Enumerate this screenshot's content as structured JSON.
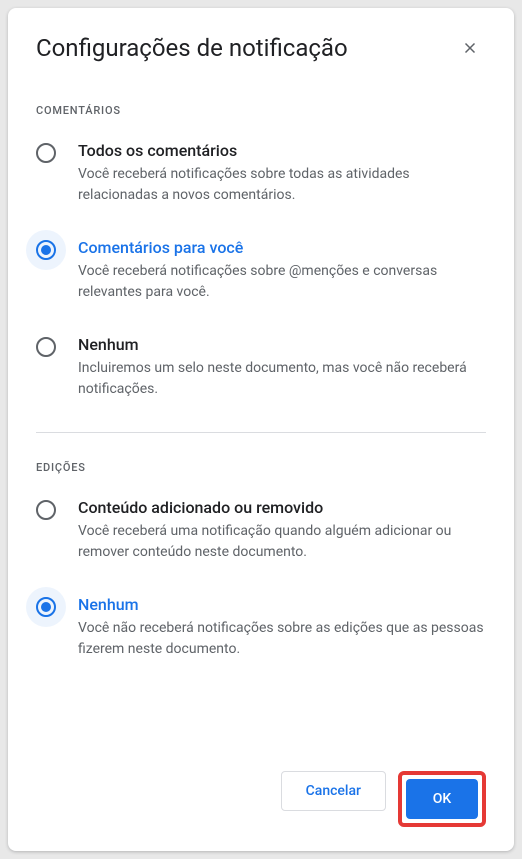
{
  "dialog": {
    "title": "Configurações de notificação"
  },
  "sections": {
    "comments": {
      "label": "COMENTÁRIOS",
      "options": [
        {
          "title": "Todos os comentários",
          "description": "Você receberá notificações sobre todas as atividades relacionadas a novos comentários.",
          "selected": false
        },
        {
          "title": "Comentários para você",
          "description": "Você receberá notificações sobre @menções e conversas relevantes para você.",
          "selected": true
        },
        {
          "title": "Nenhum",
          "description": "Incluiremos um selo neste documento, mas você não receberá notificações.",
          "selected": false
        }
      ]
    },
    "edits": {
      "label": "EDIÇÕES",
      "options": [
        {
          "title": "Conteúdo adicionado ou removido",
          "description": "Você receberá uma notificação quando alguém adicionar ou remover conteúdo neste documento.",
          "selected": false
        },
        {
          "title": "Nenhum",
          "description": "Você não receberá notificações sobre as edições que as pessoas fizerem neste documento.",
          "selected": true
        }
      ]
    }
  },
  "footer": {
    "cancel_label": "Cancelar",
    "ok_label": "OK"
  }
}
